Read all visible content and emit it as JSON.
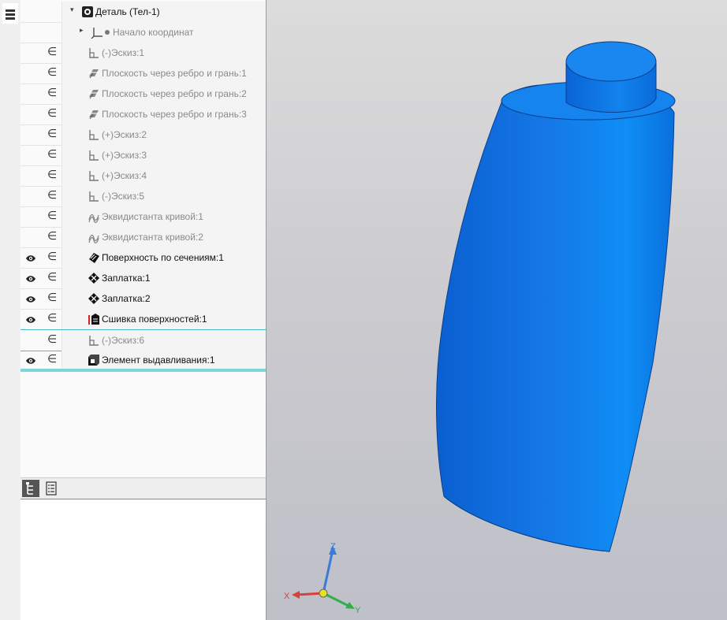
{
  "tree": {
    "root": {
      "label": "Деталь (Тел-1)",
      "icon": "part-icon"
    },
    "origin": {
      "label": "Начало координат",
      "icon": "axis-origin-icon"
    },
    "items": [
      {
        "label": "(-)Эскиз:1",
        "icon": "sketch-icon",
        "visible": false,
        "dim": true
      },
      {
        "label": "Плоскость через ребро и грань:1",
        "icon": "plane-icon",
        "visible": false,
        "dim": true
      },
      {
        "label": "Плоскость через ребро и грань:2",
        "icon": "plane-icon",
        "visible": false,
        "dim": true
      },
      {
        "label": "Плоскость через ребро и грань:3",
        "icon": "plane-icon",
        "visible": false,
        "dim": true
      },
      {
        "label": "(+)Эскиз:2",
        "icon": "sketch-icon",
        "visible": false,
        "dim": true
      },
      {
        "label": "(+)Эскиз:3",
        "icon": "sketch-icon",
        "visible": false,
        "dim": true
      },
      {
        "label": "(+)Эскиз:4",
        "icon": "sketch-icon",
        "visible": false,
        "dim": true
      },
      {
        "label": "(-)Эскиз:5",
        "icon": "sketch-icon",
        "visible": false,
        "dim": true
      },
      {
        "label": "Эквидистанта кривой:1",
        "icon": "offset-curve-icon",
        "visible": false,
        "dim": true
      },
      {
        "label": "Эквидистанта кривой:2",
        "icon": "offset-curve-icon",
        "visible": false,
        "dim": true
      },
      {
        "label": "Поверхность по сечениям:1",
        "icon": "loft-surface-icon",
        "visible": true,
        "dim": false
      },
      {
        "label": "Заплатка:1",
        "icon": "patch-icon",
        "visible": true,
        "dim": false
      },
      {
        "label": "Заплатка:2",
        "icon": "patch-icon",
        "visible": true,
        "dim": false
      },
      {
        "label": "Сшивка поверхностей:1",
        "icon": "stitch-surface-icon",
        "visible": true,
        "dim": false
      },
      {
        "label": "(-)Эскиз:6",
        "icon": "sketch-icon",
        "visible": false,
        "dim": true
      },
      {
        "label": "Элемент выдавливания:1",
        "icon": "extrude-icon",
        "visible": true,
        "dim": false
      }
    ]
  },
  "tabs": [
    {
      "name": "tree-tab",
      "icon": "tree-structure-icon",
      "active": true
    },
    {
      "name": "properties-tab",
      "icon": "list-icon",
      "active": false
    }
  ],
  "axes": {
    "x": "X",
    "y": "Y",
    "z": "Z"
  },
  "colors": {
    "model": "#1a7de6",
    "highlight": "#4fb8c8"
  }
}
